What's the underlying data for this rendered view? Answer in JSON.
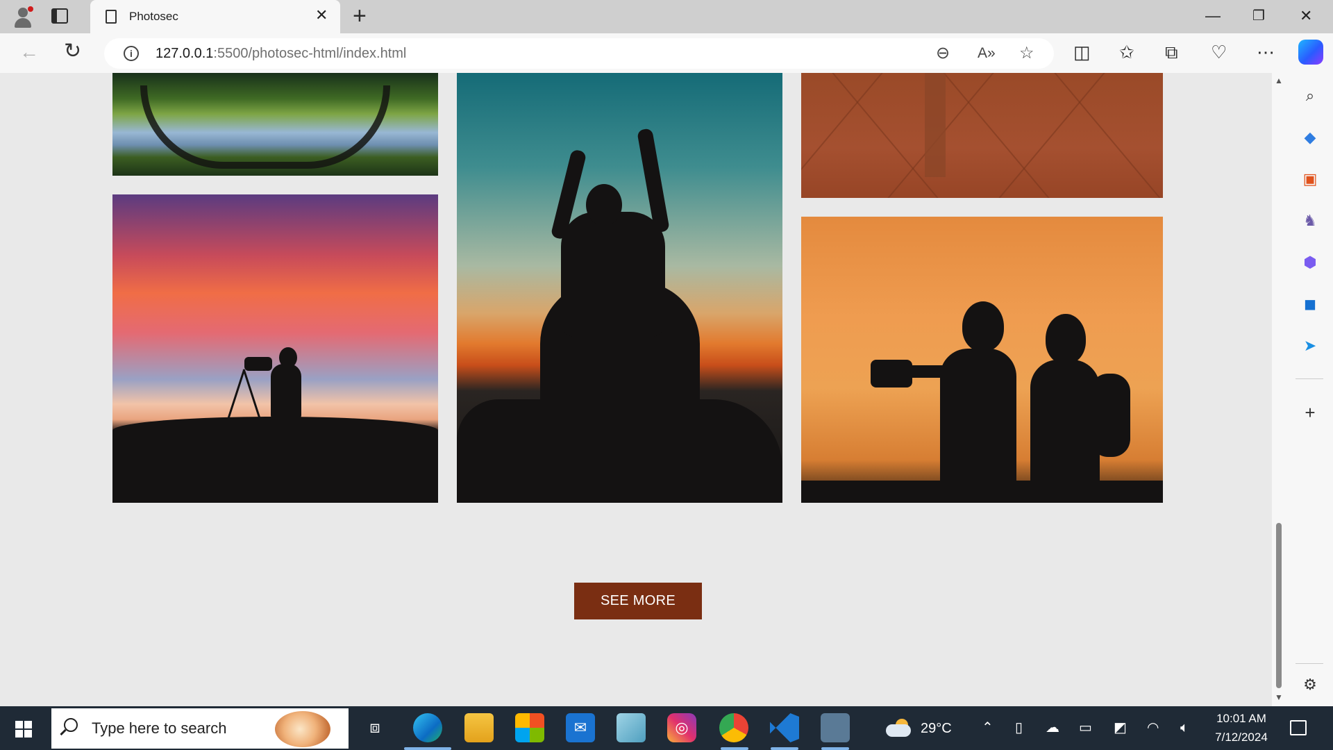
{
  "browser": {
    "tab_title": "Photosec",
    "url_host": "127.0.0.1",
    "url_rest": ":5500/photosec-html/index.html",
    "new_tab_symbol": "+",
    "close_symbol": "✕"
  },
  "page": {
    "see_more_label": "SEE MORE",
    "photos": [
      {
        "name": "lake-reflection-photo"
      },
      {
        "name": "woman-silhouette-sunset-photo"
      },
      {
        "name": "orange-tripod-photo"
      },
      {
        "name": "photographer-sunset-photo"
      },
      {
        "name": "two-photographers-photo"
      }
    ]
  },
  "taskbar": {
    "search_placeholder": "Type here to search",
    "weather_temp": "29°C",
    "time": "10:01 AM",
    "date": "7/12/2024"
  },
  "colors": {
    "accent_button": "#7a2e12",
    "taskbar": "#1f2a36"
  }
}
